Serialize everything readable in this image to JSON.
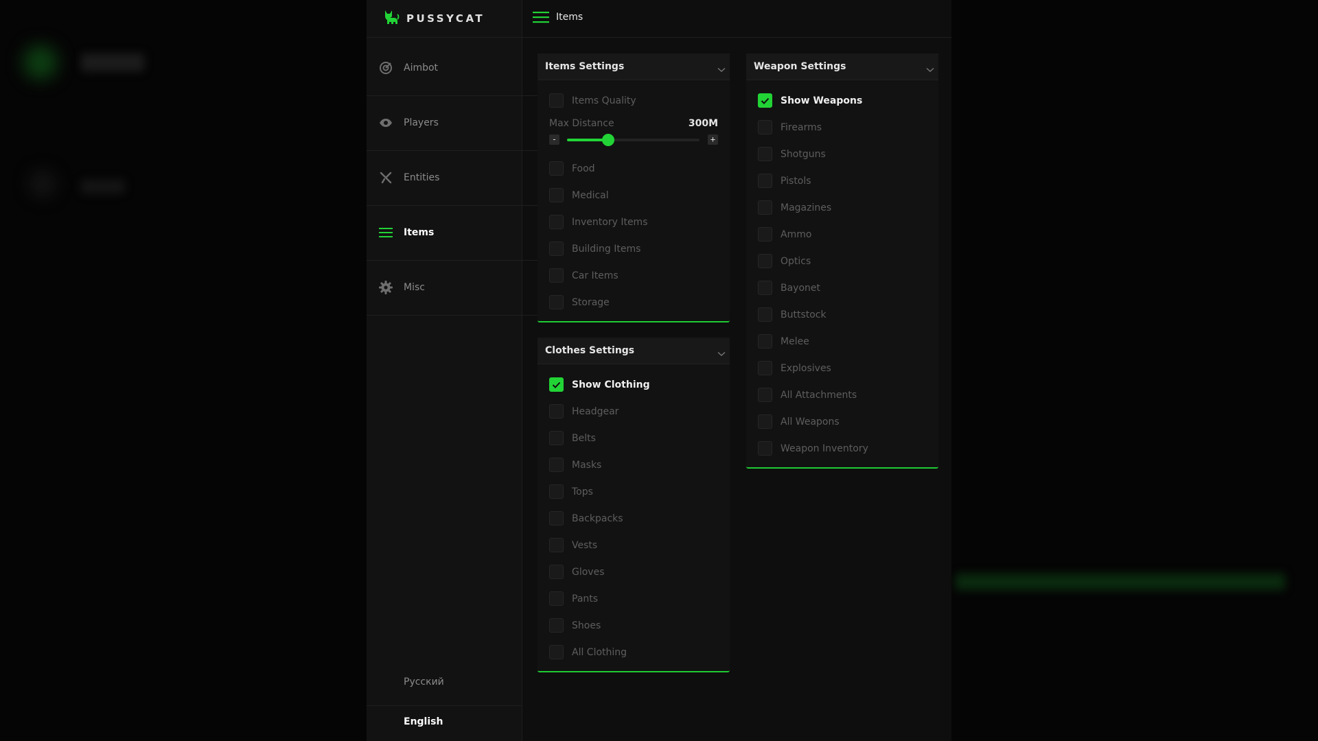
{
  "brand": {
    "name": "PUSSYCAT",
    "accent": "#22d336"
  },
  "header": {
    "title": "Items"
  },
  "sidebar": {
    "items": [
      {
        "label": "Aimbot",
        "icon": "target-icon"
      },
      {
        "label": "Players",
        "icon": "eye-icon"
      },
      {
        "label": "Entities",
        "icon": "entities-icon"
      },
      {
        "label": "Items",
        "icon": "list-icon",
        "active": true
      },
      {
        "label": "Misc",
        "icon": "gear-icon"
      }
    ],
    "languages": [
      {
        "label": "Русский"
      },
      {
        "label": "English",
        "active": true
      }
    ]
  },
  "items_settings": {
    "title": "Items Settings",
    "quality": {
      "label": "Items Quality",
      "checked": false
    },
    "distance": {
      "label": "Max Distance",
      "value": "300M",
      "fraction": 0.31,
      "minus": "-",
      "plus": "+"
    },
    "options": [
      {
        "label": "Food",
        "checked": false
      },
      {
        "label": "Medical",
        "checked": false
      },
      {
        "label": "Inventory Items",
        "checked": false
      },
      {
        "label": "Building Items",
        "checked": false
      },
      {
        "label": "Car Items",
        "checked": false
      },
      {
        "label": "Storage",
        "checked": false
      }
    ]
  },
  "clothes_settings": {
    "title": "Clothes Settings",
    "options": [
      {
        "label": "Show Clothing",
        "checked": true
      },
      {
        "label": "Headgear",
        "checked": false
      },
      {
        "label": "Belts",
        "checked": false
      },
      {
        "label": "Masks",
        "checked": false
      },
      {
        "label": "Tops",
        "checked": false
      },
      {
        "label": "Backpacks",
        "checked": false
      },
      {
        "label": "Vests",
        "checked": false
      },
      {
        "label": "Gloves",
        "checked": false
      },
      {
        "label": "Pants",
        "checked": false
      },
      {
        "label": "Shoes",
        "checked": false
      },
      {
        "label": "All Clothing",
        "checked": false
      }
    ]
  },
  "weapon_settings": {
    "title": "Weapon Settings",
    "options": [
      {
        "label": "Show Weapons",
        "checked": true
      },
      {
        "label": "Firearms",
        "checked": false
      },
      {
        "label": "Shotguns",
        "checked": false
      },
      {
        "label": "Pistols",
        "checked": false
      },
      {
        "label": "Magazines",
        "checked": false
      },
      {
        "label": "Ammo",
        "checked": false
      },
      {
        "label": "Optics",
        "checked": false
      },
      {
        "label": "Bayonet",
        "checked": false
      },
      {
        "label": "Buttstock",
        "checked": false
      },
      {
        "label": "Melee",
        "checked": false
      },
      {
        "label": "Explosives",
        "checked": false
      },
      {
        "label": "All Attachments",
        "checked": false
      },
      {
        "label": "All Weapons",
        "checked": false
      },
      {
        "label": "Weapon Inventory",
        "checked": false
      }
    ]
  }
}
